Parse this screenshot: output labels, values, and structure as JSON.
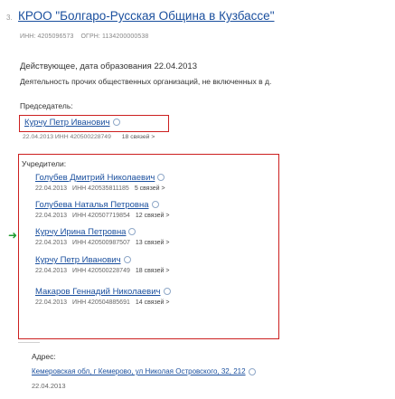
{
  "item_number": "3.",
  "org_title": "КРОО \"Болгаро-Русская Община в Кузбассе\"",
  "inn": "ИНН: 4205096573",
  "ogrn": "ОГРН: 1134200000538",
  "status": "Действующее, дата образования 22.04.2013",
  "activity": "Деятельность прочих общественных организаций, не включенных в д.",
  "chair": {
    "label": "Председатель:",
    "name": "Курчу Петр Иванович",
    "meta": "22.04.2013    ИНН 420500228749",
    "count": "18 связей >"
  },
  "founders": {
    "label": "Учредители:",
    "items": [
      {
        "name": "Голубев Дмитрий Николаевич",
        "date": "22.04.2013",
        "inn": "ИНН 420535811185",
        "count": "5 связей >"
      },
      {
        "name": "Голубева Наталья Петровна",
        "date": "22.04.2013",
        "inn": "ИНН 420507719854",
        "count": "12 связей >"
      },
      {
        "name": "Курчу Ирина Петровна",
        "date": "22.04.2013",
        "inn": "ИНН 420500987507",
        "count": "13 связей >"
      },
      {
        "name": "Курчу Петр Иванович",
        "date": "22.04.2013",
        "inn": "ИНН 420500228749",
        "count": "18 связей >"
      },
      {
        "name": "Макаров Геннадий Николаевич",
        "date": "22.04.2013",
        "inn": "ИНН 420504885691",
        "count": "14 связей >"
      }
    ]
  },
  "address": {
    "label": "Адрес:",
    "value": "Кемеровская обл, г Кемерово, ул Николая Островского, 32,  212",
    "date": "22.04.2013"
  },
  "icons": {
    "arrow": "green-right-arrow-icon",
    "search": "magnifier-icon"
  },
  "colors": {
    "link": "#1a4f9e",
    "highlight_border": "#cc1f1f",
    "arrow": "#1e9b2e"
  }
}
